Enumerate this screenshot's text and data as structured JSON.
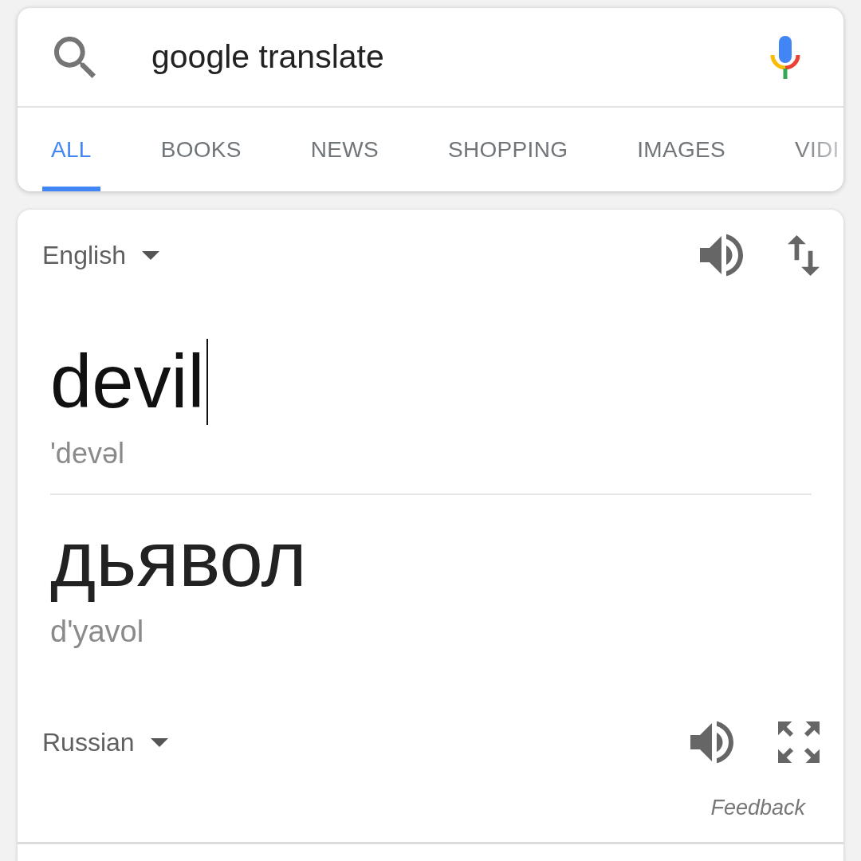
{
  "search": {
    "query": "google translate"
  },
  "tabs": [
    {
      "label": "ALL",
      "selected": true
    },
    {
      "label": "BOOKS",
      "selected": false
    },
    {
      "label": "NEWS",
      "selected": false
    },
    {
      "label": "SHOPPING",
      "selected": false
    },
    {
      "label": "IMAGES",
      "selected": false
    },
    {
      "label": "VIDI",
      "selected": false
    }
  ],
  "translator": {
    "source": {
      "language": "English",
      "text": "devil",
      "focused": true,
      "pronunciation": "'devəl"
    },
    "target": {
      "language": "Russian",
      "text": "дьявол",
      "transliteration": "d'yavol"
    },
    "feedback": "Feedback"
  }
}
